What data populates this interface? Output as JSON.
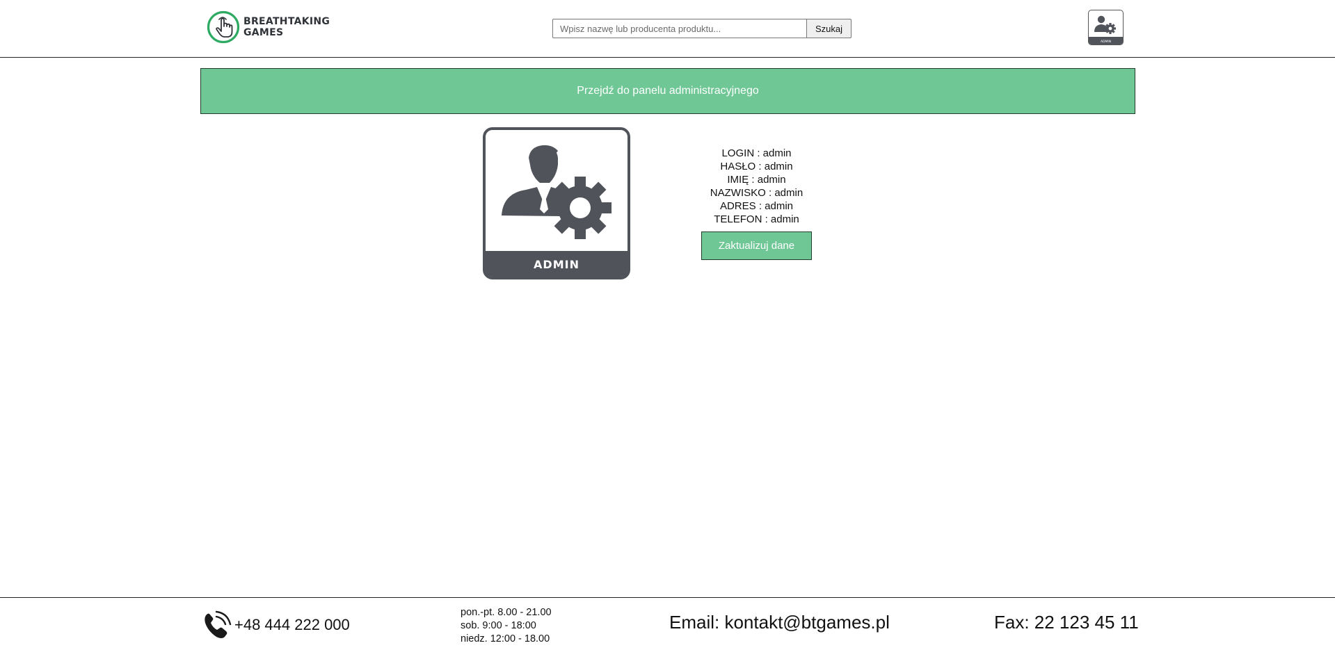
{
  "header": {
    "logo": {
      "line1": "BREATHTAKING",
      "line2": "GAMES"
    },
    "search": {
      "placeholder": "Wpisz nazwę lub producenta produktu...",
      "button_label": "Szukaj"
    },
    "account_icon": "admin-avatar-icon",
    "account_icon_label": "ADMIN"
  },
  "admin_panel_link": "Przejdź do panelu administracyjnego",
  "profile": {
    "image_label": "ADMIN",
    "fields": [
      {
        "label": "LOGIN",
        "value": "admin"
      },
      {
        "label": "HASŁO",
        "value": "admin"
      },
      {
        "label": "IMIĘ",
        "value": "admin"
      },
      {
        "label": "NAZWISKO",
        "value": "admin"
      },
      {
        "label": "ADRES",
        "value": "admin"
      },
      {
        "label": "TELEFON",
        "value": "admin"
      }
    ],
    "update_button": "Zaktualizuj dane"
  },
  "footer": {
    "phone_icon": "phone-icon",
    "phone": "+48 444 222 000",
    "hours": [
      "pon.-pt. 8.00 - 21.00",
      "sob. 9:00 - 18:00",
      "niedz. 12:00 - 18.00"
    ],
    "email": "Email: kontakt@btgames.pl",
    "fax": "Fax: 22 123 45 11"
  },
  "colors": {
    "accent": "#6fc796",
    "logo_green": "#2eaa62",
    "icon_dark": "#50535a"
  }
}
